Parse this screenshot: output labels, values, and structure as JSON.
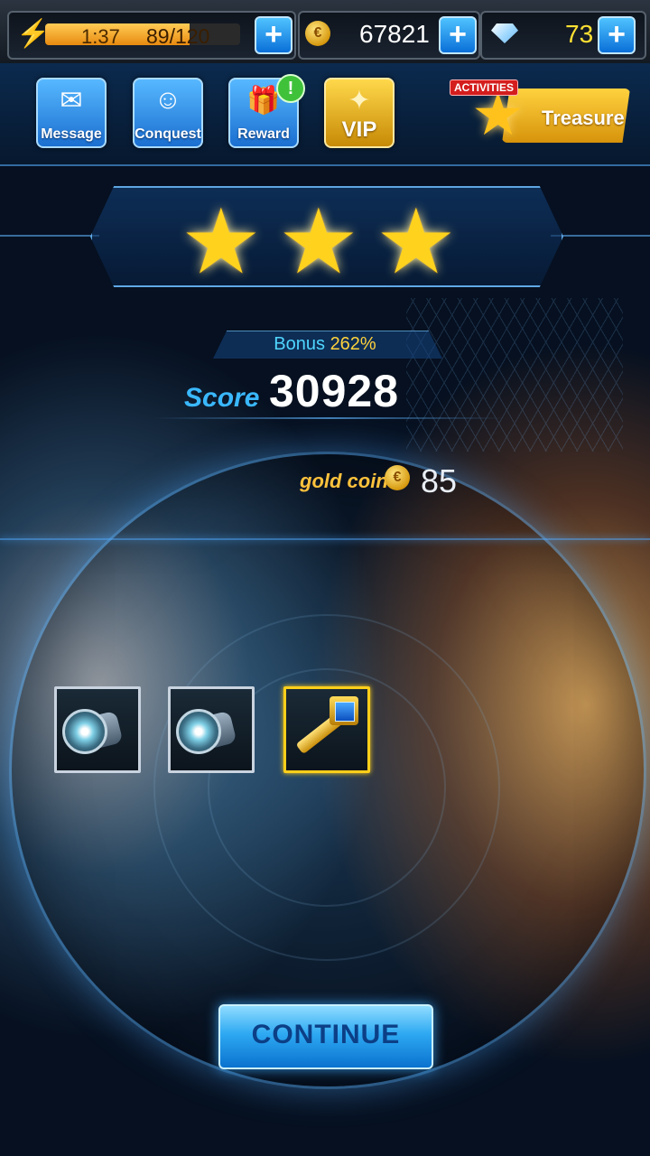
{
  "status_bar": {
    "energy_timer": "1:37",
    "energy_value": "89/120",
    "energy_fill_fraction": 0.74,
    "gold": "67821",
    "gems": "73",
    "icons": [
      "bolt-icon",
      "gold-coin-icon",
      "diamond-icon",
      "plus-icon"
    ]
  },
  "menu": {
    "message": "Message",
    "conquest": "Conquest",
    "reward": "Reward",
    "reward_alert": "!",
    "vip": "VIP",
    "activities_tag": "ACTIVITIES",
    "treasure": "Treasure"
  },
  "result": {
    "stars_earned": 3,
    "stars_total": 3,
    "bonus_label": "Bonus",
    "bonus_value": "262%",
    "score_label": "Score",
    "score_value": "30928",
    "gold_coin_label": "gold coin",
    "gold_coin_value": "85"
  },
  "rewards": [
    {
      "item": "engine-part",
      "frame": "silver"
    },
    {
      "item": "engine-part",
      "frame": "silver"
    },
    {
      "item": "gold-key",
      "frame": "gold"
    }
  ],
  "continue_label": "CONTINUE",
  "colors": {
    "accent_blue": "#3ab8ff",
    "gold": "#ffd21e",
    "bonus_text": "#4fd6ff",
    "bonus_value": "#ffd23c"
  }
}
